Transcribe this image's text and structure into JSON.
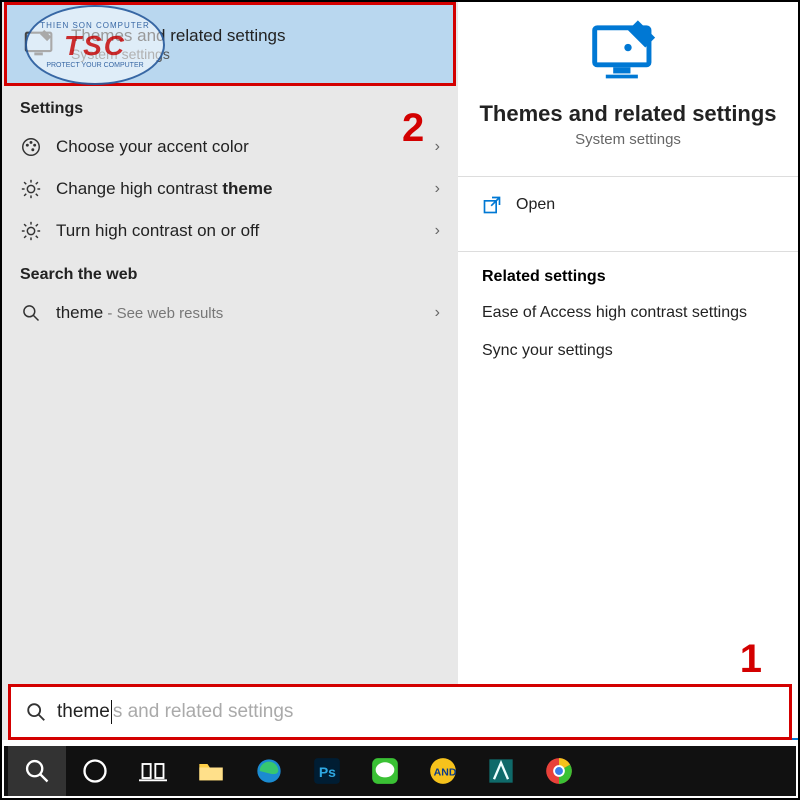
{
  "bestMatch": {
    "title": "Themes and related settings",
    "subtitle": "System settings"
  },
  "sections": {
    "settingsHeader": "Settings",
    "webHeader": "Search the web"
  },
  "settingsItems": [
    {
      "label": "Choose your accent color"
    },
    {
      "labelPrefix": "Change high contrast ",
      "labelBold": "theme"
    },
    {
      "label": "Turn high contrast on or off"
    }
  ],
  "webItem": {
    "term": "theme",
    "suffix": " - See web results"
  },
  "preview": {
    "title": "Themes and related settings",
    "subtitle": "System settings",
    "open": "Open",
    "relatedHeader": "Related settings",
    "related": [
      "Ease of Access high contrast settings",
      "Sync your settings"
    ]
  },
  "search": {
    "typed": "theme",
    "ghost": "s and related settings"
  },
  "annotations": {
    "one": "1",
    "two": "2"
  },
  "logo": {
    "top": "THIEN SON COMPUTER",
    "main": "TSC",
    "bot": "PROTECT YOUR COMPUTER"
  }
}
